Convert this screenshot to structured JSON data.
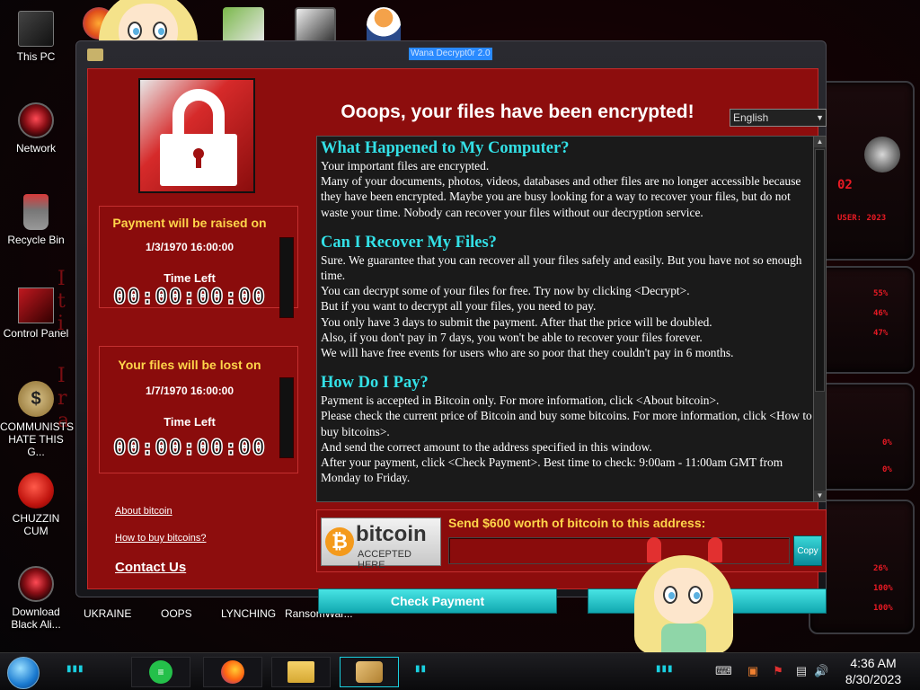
{
  "desktop": {
    "icons": [
      {
        "label": "This PC",
        "icon": "computer-icon"
      },
      {
        "label": "Network",
        "icon": "alien-network-icon"
      },
      {
        "label": "Recycle Bin",
        "icon": "recycle-bin-icon"
      },
      {
        "label": "Control Panel",
        "icon": "control-panel-icon"
      },
      {
        "label": "COMMUNISTS HATE THIS G...",
        "icon": "money-bag-icon"
      },
      {
        "label": "CHUZZIN CUM",
        "icon": "fuzzball-icon"
      },
      {
        "label": "Download Black Ali...",
        "icon": "alien-download-icon"
      }
    ],
    "bottom_labels": [
      "UKRAINE",
      "OOPS",
      "LYNCHING",
      "RansomWar..."
    ],
    "top_icons": [
      "firefox-icon",
      "hxd-icon",
      "maze-icon",
      "person-icon"
    ]
  },
  "window": {
    "title": "Wana Decrypt0r 2.0",
    "heading": "Ooops, your files have been encrypted!",
    "language": "English",
    "raise_panel": {
      "title": "Payment will be raised on",
      "date": "1/3/1970 16:00:00",
      "time_left_label": "Time Left",
      "countdown": "00:00:00:00"
    },
    "lost_panel": {
      "title": "Your files will be lost on",
      "date": "1/7/1970 16:00:00",
      "time_left_label": "Time Left",
      "countdown": "00:00:00:00"
    },
    "links": {
      "about_bitcoin": "About bitcoin",
      "how_to_buy": "How to buy bitcoins?",
      "contact_us": "Contact Us"
    },
    "message": {
      "h1": "What Happened to My Computer?",
      "p1": [
        "Your important files are encrypted.",
        "Many of your documents, photos, videos, databases and other files are no longer accessible because they have been encrypted. Maybe you are busy looking for a way to recover your files, but do not waste your time. Nobody can recover your files without our decryption service."
      ],
      "h2": "Can I Recover My Files?",
      "p2": [
        "Sure. We guarantee that you can recover all your files safely and easily. But you have not so enough time.",
        "You can decrypt some of your files for free. Try now by clicking <Decrypt>.",
        "But if you want to decrypt all your files, you need to pay.",
        "You only have 3 days to submit the payment. After that the price will be doubled.",
        "Also, if you don't pay in 7 days, you won't be able to recover your files forever.",
        "We will have free events for users who are so poor that they couldn't pay in 6 months."
      ],
      "h3": "How Do I Pay?",
      "p3": [
        "Payment is accepted in Bitcoin only. For more information, click <About bitcoin>.",
        "Please check the current price of Bitcoin and buy some bitcoins. For more information, click <How to buy bitcoins>.",
        "And send the correct amount to the address specified in this window.",
        "After your payment, click <Check Payment>. Best time to check: 9:00am - 11:00am GMT from Monday to Friday."
      ]
    },
    "bitcoin": {
      "logo_word": "bitcoin",
      "logo_sub": "ACCEPTED HERE",
      "send_label": "Send $600 worth of bitcoin to this address:",
      "address": "",
      "copy_label": "Copy"
    },
    "buttons": {
      "check_payment": "Check Payment",
      "decrypt": ""
    }
  },
  "taskbar": {
    "time": "4:36 AM",
    "date": "8/30/2023",
    "apps": [
      "notes-icon",
      "firefox-icon",
      "file-explorer-icon",
      "handshake-icon"
    ]
  },
  "colors": {
    "window_red": "#8d0d0d",
    "heading_cyan": "#33e0e6",
    "panel_yellow": "#ffd54a",
    "button_teal": "#11a8b0"
  }
}
